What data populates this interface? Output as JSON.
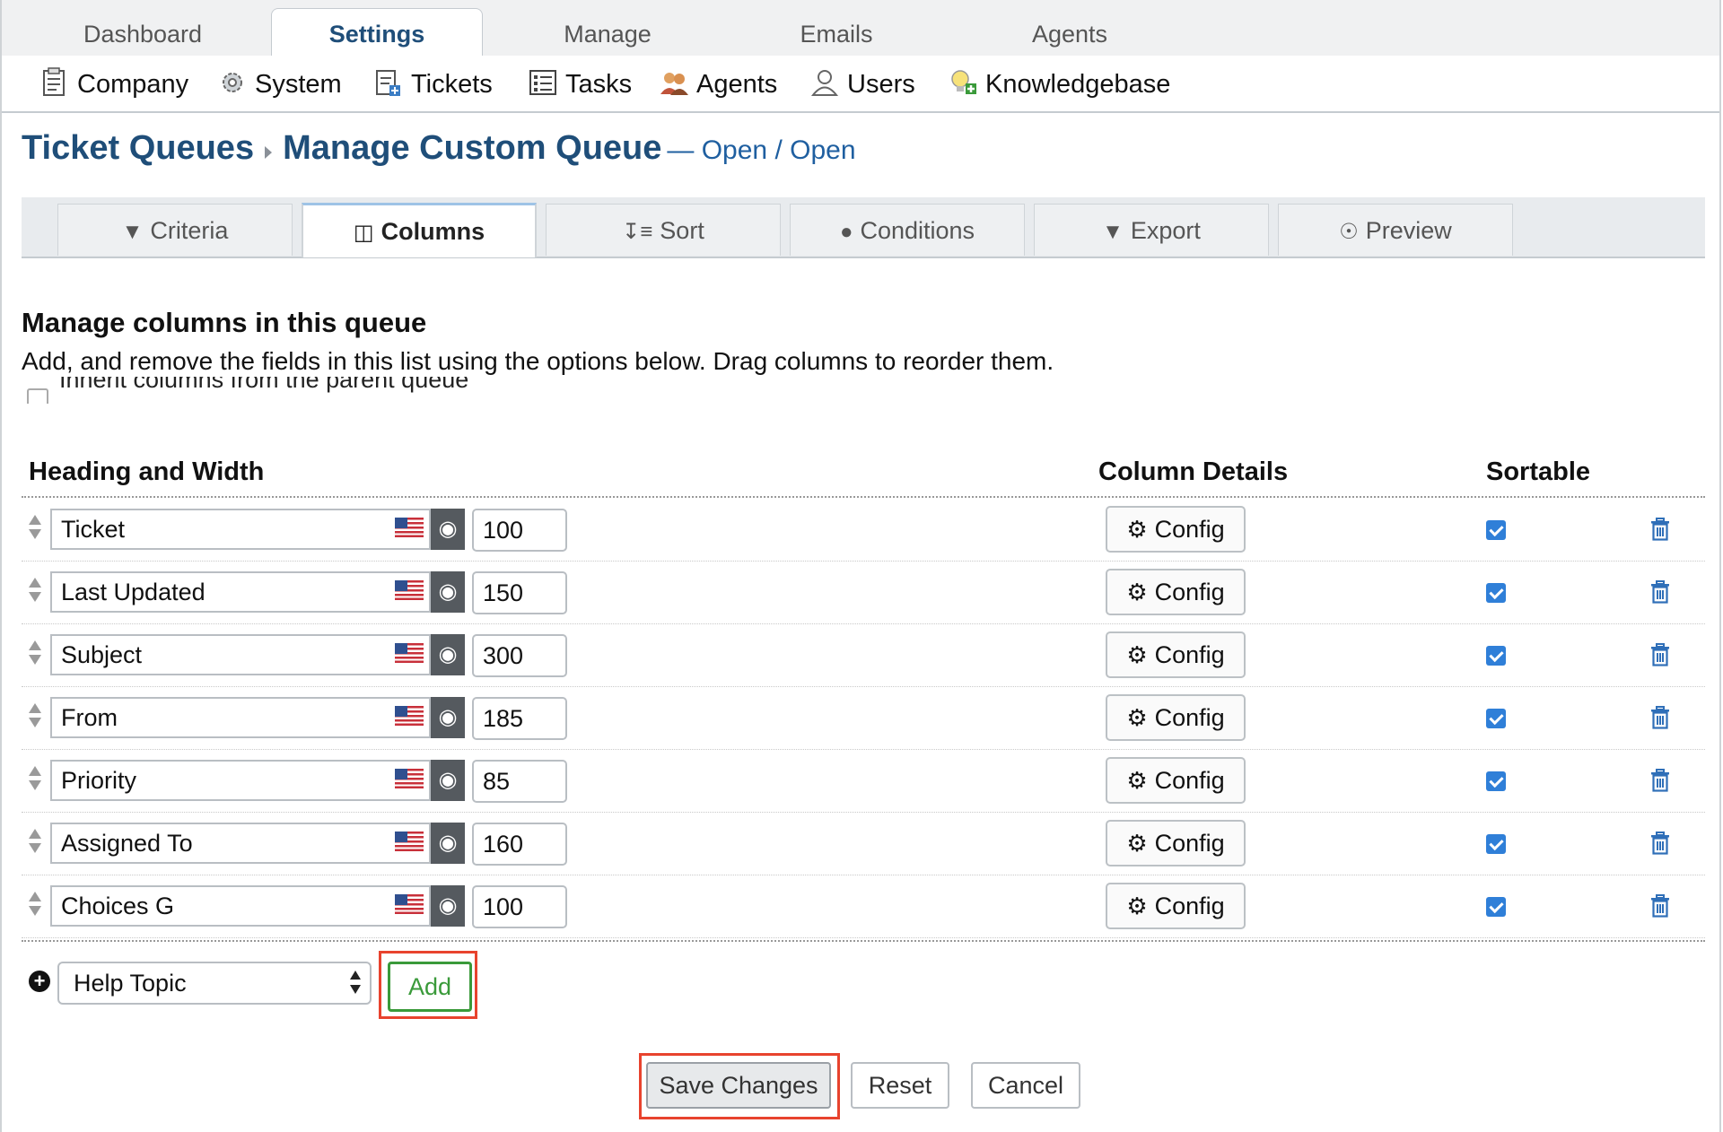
{
  "top_tabs": [
    "Dashboard",
    "Settings",
    "Manage",
    "Emails",
    "Agents"
  ],
  "active_top_tab": "Settings",
  "sub_nav": [
    {
      "label": "Company",
      "icon": "company-icon"
    },
    {
      "label": "System",
      "icon": "system-gear-icon"
    },
    {
      "label": "Tickets",
      "icon": "tickets-icon"
    },
    {
      "label": "Tasks",
      "icon": "tasks-icon"
    },
    {
      "label": "Agents",
      "icon": "agents-icon"
    },
    {
      "label": "Users",
      "icon": "users-icon"
    },
    {
      "label": "Knowledgebase",
      "icon": "knowledgebase-icon"
    }
  ],
  "title": {
    "crumb1": "Ticket Queues",
    "crumb2": "Manage Custom Queue",
    "subtitle": "— Open / Open"
  },
  "section_tabs": [
    {
      "label": "Criteria",
      "icon": "filter-icon"
    },
    {
      "label": "Columns",
      "icon": "columns-icon"
    },
    {
      "label": "Sort",
      "icon": "sort-icon"
    },
    {
      "label": "Conditions",
      "icon": "alert-icon"
    },
    {
      "label": "Export",
      "icon": "download-icon"
    },
    {
      "label": "Preview",
      "icon": "eye-icon"
    }
  ],
  "active_section_tab": "Columns",
  "manage": {
    "heading": "Manage columns in this queue",
    "description": "Add, and remove the fields in this list using the options below. Drag columns to reorder them.",
    "inherit_label": "Inherit columns from the parent queue",
    "inherit_checked": false
  },
  "table_headers": {
    "heading_width": "Heading and Width",
    "column_details": "Column Details",
    "sortable": "Sortable"
  },
  "columns": [
    {
      "heading": "Ticket",
      "width": "100",
      "config": "Config",
      "sortable": true
    },
    {
      "heading": "Last Updated",
      "width": "150",
      "config": "Config",
      "sortable": true
    },
    {
      "heading": "Subject",
      "width": "300",
      "config": "Config",
      "sortable": true
    },
    {
      "heading": "From",
      "width": "185",
      "config": "Config",
      "sortable": true
    },
    {
      "heading": "Priority",
      "width": "85",
      "config": "Config",
      "sortable": true
    },
    {
      "heading": "Assigned To",
      "width": "160",
      "config": "Config",
      "sortable": true
    },
    {
      "heading": "Choices G",
      "width": "100",
      "config": "Config",
      "sortable": true
    }
  ],
  "add_column": {
    "selected": "Help Topic",
    "add_label": "Add"
  },
  "actions": {
    "save": "Save Changes",
    "reset": "Reset",
    "cancel": "Cancel"
  },
  "colors": {
    "brand_blue": "#1f4e79",
    "highlight_red": "#e8432e",
    "add_green": "#3a9a3a",
    "checkbox_blue": "#2f7fd8"
  }
}
